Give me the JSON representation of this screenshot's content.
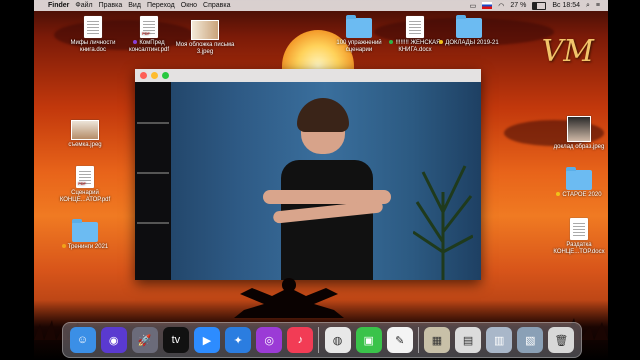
{
  "menubar": {
    "apple": "",
    "items": [
      "Finder",
      "Файл",
      "Правка",
      "Вид",
      "Переход",
      "Окно",
      "Справка"
    ],
    "battery": "27 %",
    "clock": "Вс 18:54"
  },
  "desktop": {
    "left_icons": [
      {
        "label": "Мифы личности книга.doc",
        "kind": "doc"
      },
      {
        "label": "КомПред консалтинг.pdf",
        "kind": "pdf",
        "tag": "#8a3fd8"
      },
      {
        "label": "Моя обложка письма 3.jpeg",
        "kind": "image"
      },
      {
        "label": "съемка.jpeg",
        "kind": "image"
      },
      {
        "label": "Сценарий КОНЦЕ...АТОР.pdf",
        "kind": "pdf"
      },
      {
        "label": "Тренинги 2021",
        "kind": "folder",
        "tag": "#f0a21a"
      }
    ],
    "top_icons": [
      {
        "label": "100 упражнений сценарии",
        "kind": "folder"
      },
      {
        "label": "!!!!!!!! ЖЕНСКАЯ КНИГА.docx",
        "kind": "doc",
        "tag": "#2fb54a"
      },
      {
        "label": "ДОКЛАДЫ 2019-21",
        "kind": "folder",
        "tag": "#f0c21a"
      }
    ],
    "right_icons": [
      {
        "label": "доклад образ.jpeg",
        "kind": "image"
      },
      {
        "label": "СТАРОЕ 2020",
        "kind": "folder",
        "tag": "#f0c21a"
      },
      {
        "label": "Раздатка КОНЦЕ...ТОР.docx",
        "kind": "doc"
      }
    ],
    "logo": "VM"
  },
  "dock": {
    "apps": [
      {
        "name": "finder-icon",
        "glyph": "☺",
        "color": "#3b8fe6"
      },
      {
        "name": "siri-icon",
        "glyph": "◉",
        "color": "#5a3ad0"
      },
      {
        "name": "launchpad-icon",
        "glyph": "🚀",
        "color": "#6b6b7a"
      },
      {
        "name": "appletv-icon",
        "glyph": "tv",
        "color": "#111111"
      },
      {
        "name": "zoom-icon",
        "glyph": "▶",
        "color": "#2d8cff"
      },
      {
        "name": "safari-icon",
        "glyph": "✦",
        "color": "#2b7de0"
      },
      {
        "name": "podcasts-icon",
        "glyph": "◎",
        "color": "#9b3bd6"
      },
      {
        "name": "music-icon",
        "glyph": "♪",
        "color": "#f23c55"
      },
      {
        "name": "chrome-icon",
        "glyph": "◍",
        "color": "#e8e8e8"
      },
      {
        "name": "facetime-icon",
        "glyph": "▣",
        "color": "#3ac34a"
      },
      {
        "name": "pages-icon",
        "glyph": "✎",
        "color": "#f4f4f4"
      },
      {
        "name": "downloads-stack-icon",
        "glyph": "▦",
        "color": "#c8c0a8"
      },
      {
        "name": "documents-stack-icon",
        "glyph": "▤",
        "color": "#dcdcdc"
      },
      {
        "name": "desktop-stack-icon",
        "glyph": "▥",
        "color": "#a9b7c9"
      },
      {
        "name": "screenshots-stack-icon",
        "glyph": "▧",
        "color": "#8aa0b6"
      },
      {
        "name": "trash-icon",
        "glyph": "🗑",
        "color": "#d8d8d8"
      }
    ]
  },
  "colors": {
    "close": "#fe5f57",
    "minimize": "#febc2e",
    "zoom": "#28c840"
  }
}
